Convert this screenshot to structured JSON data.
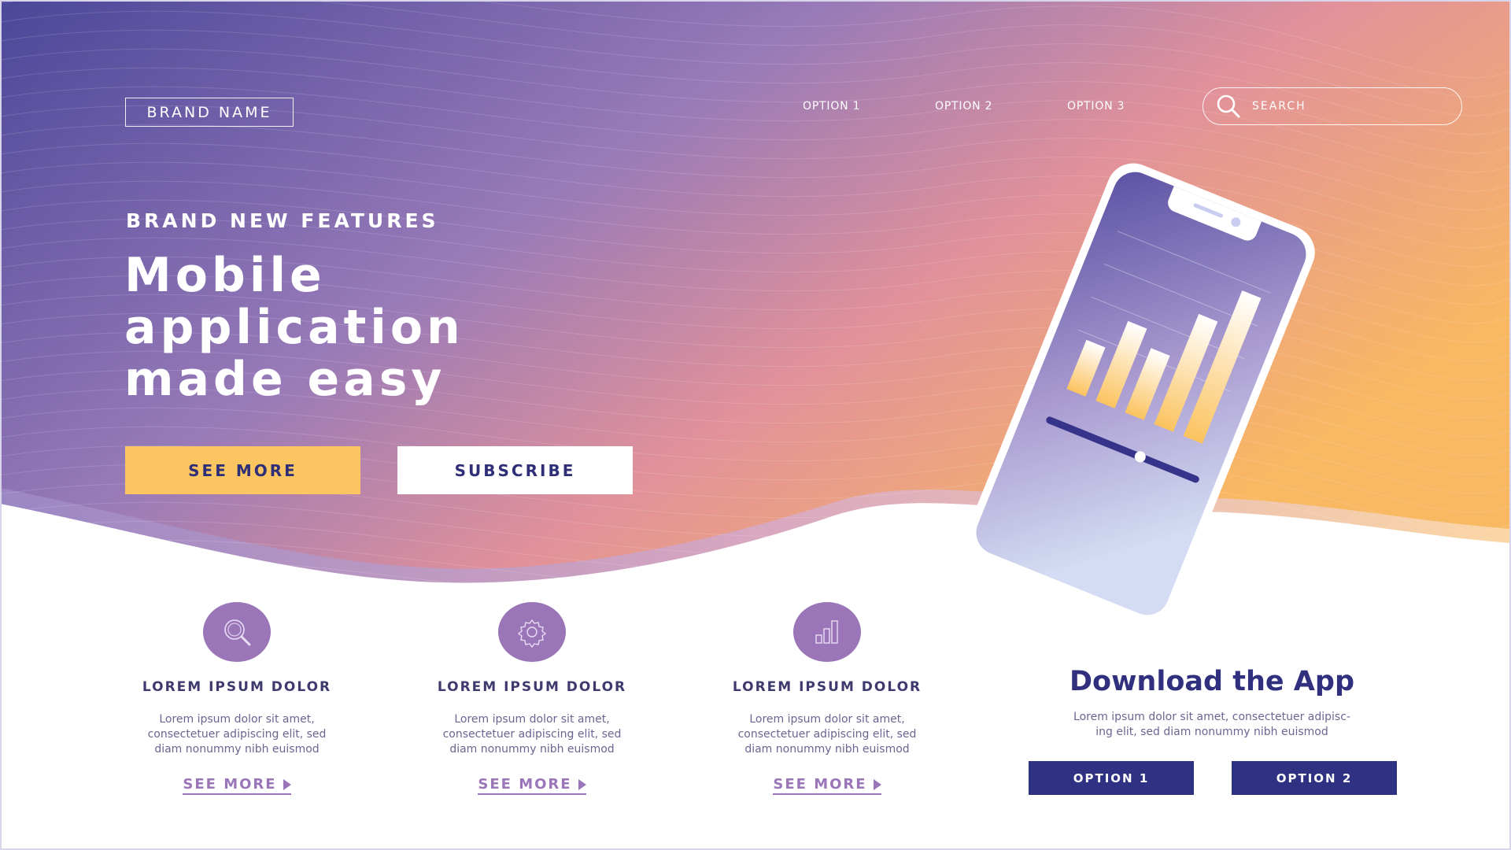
{
  "nav": {
    "brand": "BRAND NAME",
    "links": [
      "OPTION 1",
      "OPTION 2",
      "OPTION 3"
    ],
    "search_placeholder": "SEARCH",
    "search_icon": "search-icon"
  },
  "hero": {
    "eyebrow": "BRAND NEW FEATURES",
    "headline": [
      "Mobile",
      "application",
      "made easy"
    ],
    "primary_button": "SEE MORE",
    "secondary_button": "SUBSCRIBE"
  },
  "phone_screen": {
    "bar_levels": [
      0.32,
      0.52,
      0.42,
      0.72,
      0.95
    ],
    "slider_value": 0.62
  },
  "features": [
    {
      "icon": "search-icon",
      "title": "LOREM IPSUM DOLOR",
      "desc": [
        "Lorem ipsum dolor sit amet,",
        "consectetuer adipiscing elit, sed",
        "diam nonummy nibh euismod"
      ],
      "link": "SEE MORE"
    },
    {
      "icon": "gear-icon",
      "title": "LOREM IPSUM DOLOR",
      "desc": [
        "Lorem ipsum dolor sit amet,",
        "consectetuer adipiscing elit, sed",
        "diam nonummy nibh euismod"
      ],
      "link": "SEE MORE"
    },
    {
      "icon": "bar-chart-icon",
      "title": "LOREM IPSUM DOLOR",
      "desc": [
        "Lorem ipsum dolor sit amet,",
        "consectetuer adipiscing elit, sed",
        "diam nonummy nibh euismod"
      ],
      "link": "SEE MORE"
    }
  ],
  "download": {
    "title": "Download the App",
    "desc": [
      "Lorem ipsum dolor sit amet, consectetuer adipisc-",
      "ing elit, sed diam nonummy nibh euismod"
    ],
    "buttons": [
      "OPTION 1",
      "OPTION 2"
    ]
  },
  "colors": {
    "gradient_start": "#4f4a9c",
    "gradient_mid": "#9a79b7",
    "gradient_end": "#f6a862",
    "primary_button": "#fbc661",
    "accent_purple": "#9a76b9",
    "navy": "#2f3283",
    "text_dark": "#3e3a6e"
  }
}
